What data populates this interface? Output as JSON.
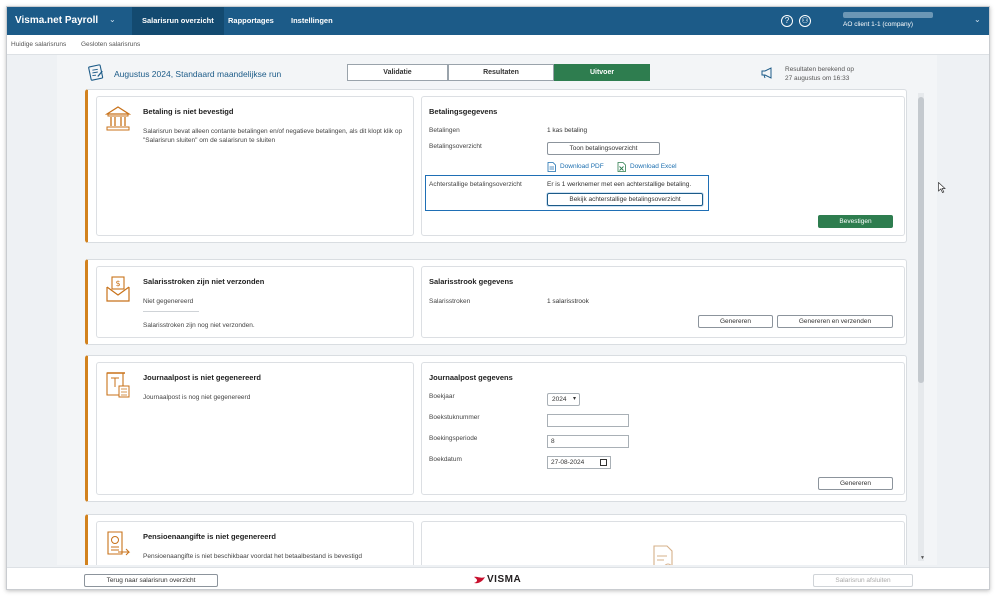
{
  "app": {
    "brand": "Visma.net Payroll",
    "company": "AO client 1-1 (company)"
  },
  "nav": {
    "tabs": [
      "Salarisrun overzicht",
      "Rapportages",
      "Instellingen"
    ]
  },
  "subnav": {
    "items": [
      "Huidige salarisruns",
      "Gesloten salarisruns"
    ]
  },
  "run": {
    "title": "Augustus 2024, Standaard maandelijkse run",
    "steps": [
      "Validatie",
      "Resultaten",
      "Uitvoer"
    ],
    "active_step": "Uitvoer",
    "result_line1": "Resultaten berekend op",
    "result_line2": "27 augustus om 16:33"
  },
  "betaling": {
    "title": "Betaling is niet bevestigd",
    "desc": "Salarisrun bevat alleen contante betalingen en/of negatieve betalingen, als dit klopt klik op \"Salarisrun sluiten\" om de salarisrun te sluiten",
    "details_title": "Betalingsgegevens",
    "label_betalingen": "Betalingen",
    "value_betalingen": "1 kas betaling",
    "label_overzicht": "Betalingsoverzicht",
    "btn_toon": "Toon betalingsoverzicht",
    "download_pdf": "Download PDF",
    "download_excel": "Download Excel",
    "label_achterstallig": "Achterstallige betalingsoverzicht",
    "value_achterstallig": "Er is 1 werknemer met een achterstallige betaling.",
    "btn_bekijk": "Bekijk achterstallige betalingsoverzicht",
    "btn_bevestigen": "Bevestigen"
  },
  "salarisstroken": {
    "title": "Salarisstroken zijn niet verzonden",
    "status": "Niet gegenereerd",
    "desc": "Salarisstroken zijn nog niet verzonden.",
    "details_title": "Salarisstrook gegevens",
    "label": "Salarisstroken",
    "value": "1 salarisstrook",
    "btn_generate": "Genereren",
    "btn_generate_send": "Genereren en verzenden"
  },
  "journaalpost": {
    "title": "Journaalpost is niet gegenereerd",
    "desc": "Journaalpost is nog niet gegenereerd",
    "details_title": "Journaalpost gegevens",
    "label_boekjaar": "Boekjaar",
    "value_boekjaar": "2024",
    "label_boekstuk": "Boekstuknummer",
    "value_boekstuk": "",
    "label_periode": "Boekingsperiode",
    "value_periode": "8",
    "label_datum": "Boekdatum",
    "value_datum": "27-08-2024",
    "btn_generate": "Genereren"
  },
  "pensioen": {
    "title": "Pensioenaangifte is niet gegenereerd",
    "desc": "Pensioenaangifte is niet beschikbaar voordat het betaalbestand is bevestigd"
  },
  "footer": {
    "btn_back": "Terug naar salarisrun overzicht",
    "logo_text": "VISMA",
    "btn_close": "Salarisrun afsluiten"
  },
  "colors": {
    "nav": "#1c5b88",
    "accent_green": "#2e7d4f",
    "warning_orange": "#d2821e",
    "link_blue": "#1c6fb0"
  }
}
